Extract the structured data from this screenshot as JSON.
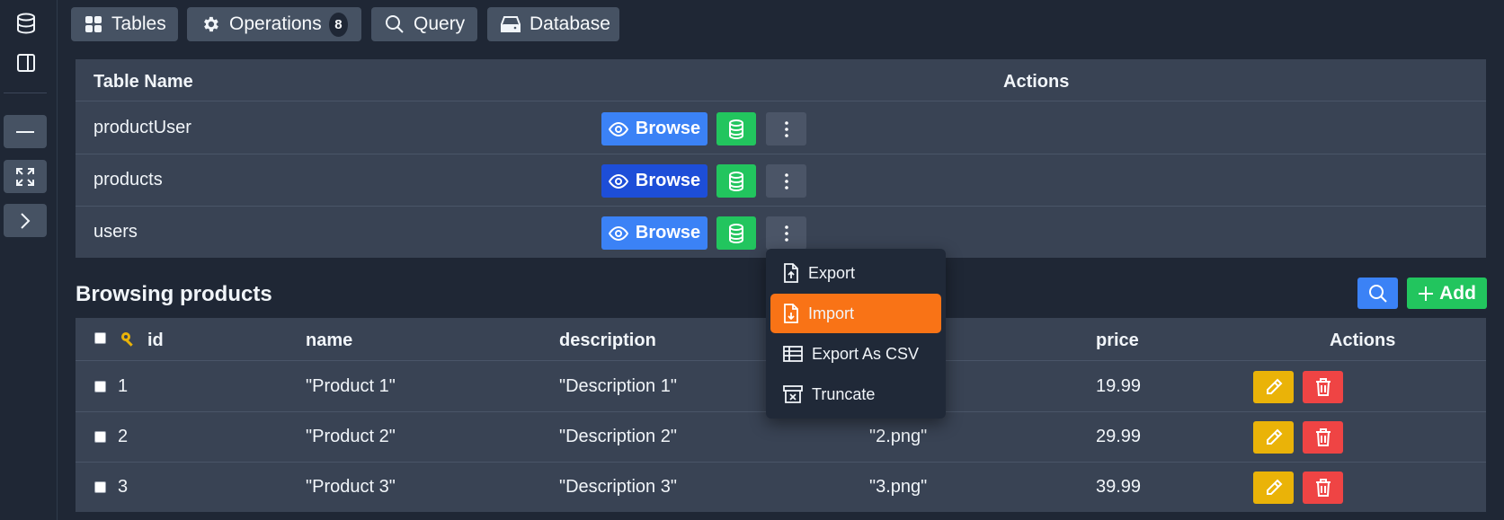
{
  "tabs": [
    {
      "label": "Tables"
    },
    {
      "label": "Operations",
      "badge": "8"
    },
    {
      "label": "Query"
    },
    {
      "label": "Database"
    }
  ],
  "tables_panel": {
    "headers": {
      "name": "Table Name",
      "actions": "Actions"
    },
    "rows": [
      {
        "name": "productUser",
        "browse_label": "Browse"
      },
      {
        "name": "products",
        "browse_label": "Browse"
      },
      {
        "name": "users",
        "browse_label": "Browse"
      }
    ]
  },
  "dropdown": {
    "items": [
      {
        "label": "Export",
        "icon": "file-export-icon"
      },
      {
        "label": "Import",
        "icon": "file-import-icon"
      },
      {
        "label": "Export As CSV",
        "icon": "table-icon"
      },
      {
        "label": "Truncate",
        "icon": "archive-x-icon"
      }
    ],
    "active_index": 1
  },
  "browsing": {
    "title": "Browsing products",
    "add_label": "Add",
    "headers": {
      "id": "id",
      "name": "name",
      "description": "description",
      "price": "price",
      "actions": "Actions"
    },
    "rows": [
      {
        "id": "1",
        "name": "\"Product 1\"",
        "description": "\"Description 1\"",
        "image": "",
        "price": "19.99"
      },
      {
        "id": "2",
        "name": "\"Product 2\"",
        "description": "\"Description 2\"",
        "image": "\"2.png\"",
        "price": "29.99"
      },
      {
        "id": "3",
        "name": "\"Product 3\"",
        "description": "\"Description 3\"",
        "image": "\"3.png\"",
        "price": "39.99"
      }
    ]
  },
  "colors": {
    "background": "#1f2735",
    "panel": "#394354",
    "browse_blue": "#3b82f6",
    "success_green": "#22c55e",
    "active_orange": "#f97316",
    "edit_yellow": "#eab308",
    "delete_red": "#ef4444"
  }
}
